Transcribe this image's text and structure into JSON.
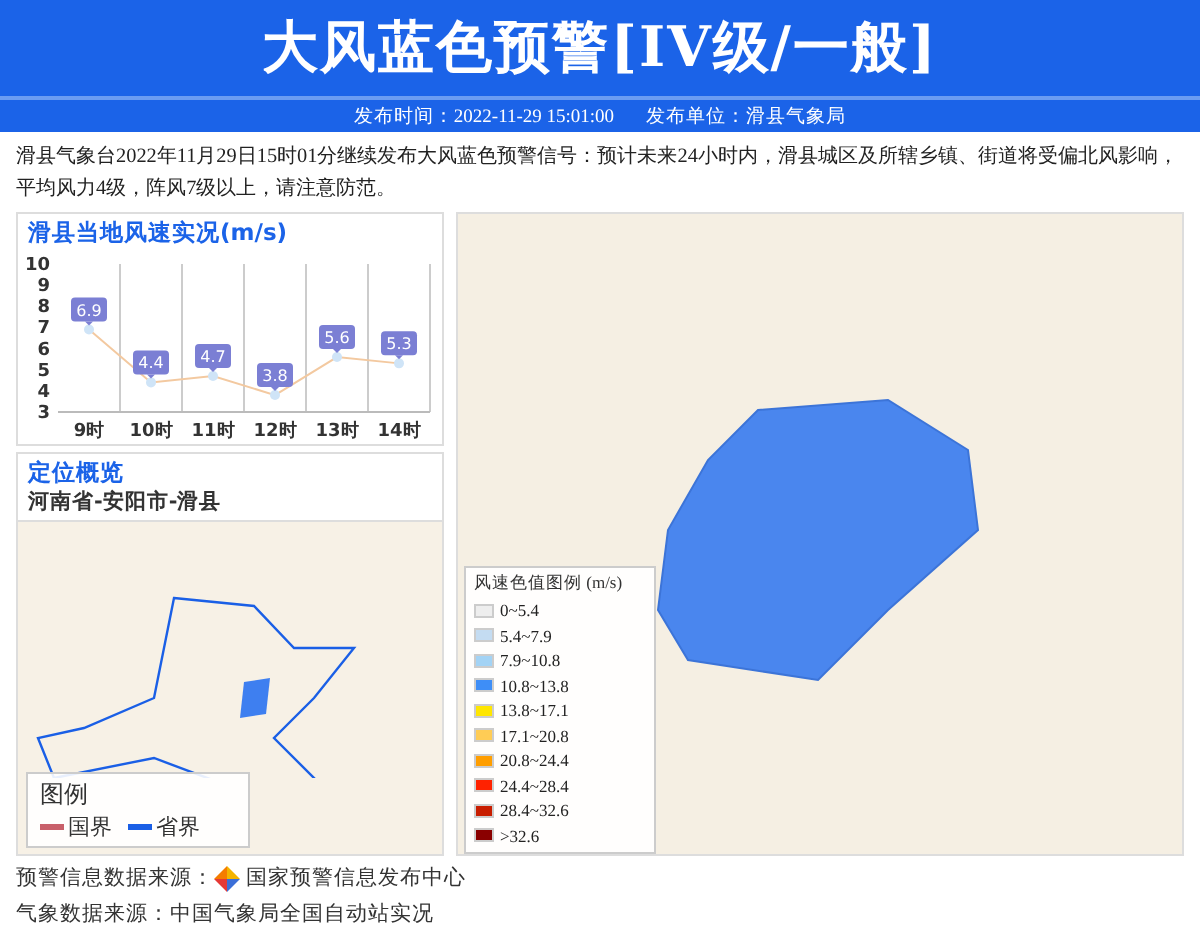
{
  "header": {
    "title": "大风蓝色预警[IV级/一般]",
    "publish_time": "发布时间：2022-11-29 15:01:00",
    "publish_unit": "发布单位：滑县气象局"
  },
  "description": "滑县气象台2022年11月29日15时01分继续发布大风蓝色预警信号：预计未来24小时内，滑县城区及所辖乡镇、街道将受偏北风影响，平均风力4级，阵风7级以上，请注意防范。",
  "wind_panel": {
    "title": "滑县当地风速实况(m/s)",
    "chart_data": {
      "type": "line",
      "categories": [
        "9时",
        "10时",
        "11时",
        "12时",
        "13时",
        "14时"
      ],
      "series": [
        {
          "color": "#f3c9a0",
          "marker": true,
          "values": [
            6.9,
            4.4,
            4.7,
            3.8,
            5.6,
            5.3
          ]
        }
      ],
      "ylim": [
        3,
        10
      ],
      "yticks": [
        3,
        4,
        5,
        6,
        7,
        8,
        9,
        10
      ],
      "data_labels": true
    }
  },
  "location_panel": {
    "title": "定位概览",
    "path": "河南省-安阳市-滑县",
    "legend": {
      "title": "图例",
      "items": [
        {
          "label": "国界",
          "color": "#c8606a"
        },
        {
          "label": "省界",
          "color": "#1a5fe6"
        }
      ]
    }
  },
  "wind_legend": {
    "title": "风速色值图例 (m/s)",
    "items": [
      {
        "label": "0~5.4",
        "color": "#eeeeee"
      },
      {
        "label": "5.4~7.9",
        "color": "#c4dcf2"
      },
      {
        "label": "7.9~10.8",
        "color": "#a3d3f5"
      },
      {
        "label": "10.8~13.8",
        "color": "#3e8ef7"
      },
      {
        "label": "13.8~17.1",
        "color": "#ffe600"
      },
      {
        "label": "17.1~20.8",
        "color": "#ffcc55"
      },
      {
        "label": "20.8~24.4",
        "color": "#ff9e00"
      },
      {
        "label": "24.4~28.4",
        "color": "#ff2200"
      },
      {
        "label": "28.4~32.6",
        "color": "#c81d00"
      },
      {
        "label": ">32.6",
        "color": "#8a0000"
      }
    ]
  },
  "sources": [
    {
      "label": "预警信息数据来源：",
      "value": "国家预警信息发布中心",
      "has_logo": true
    },
    {
      "label": "气象数据来源：",
      "value": "中国气象局全国自动站实况",
      "has_logo": false
    }
  ]
}
